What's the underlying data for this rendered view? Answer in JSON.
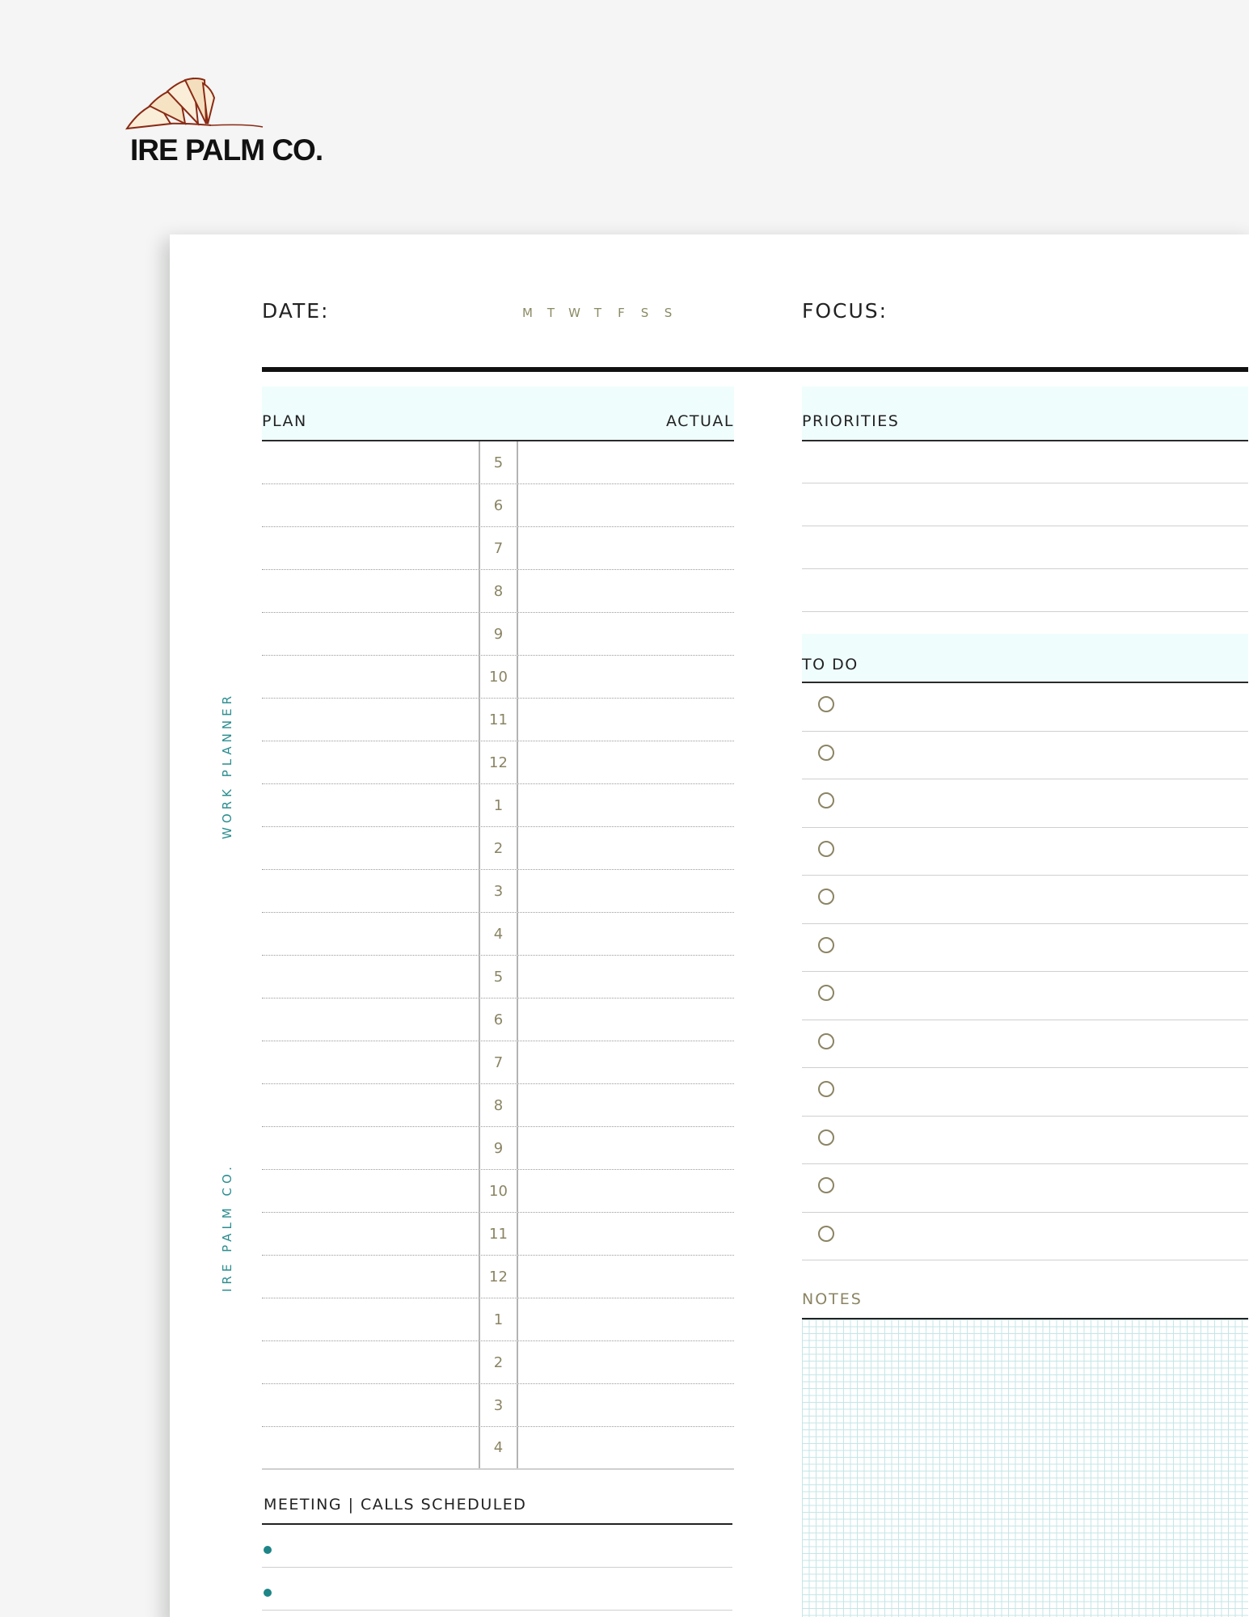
{
  "brand": {
    "name": "IRE PALM CO."
  },
  "side_labels": {
    "top": "WORK PLANNER",
    "bottom": "IRE PALM CO."
  },
  "header": {
    "date_label": "DATE:",
    "days": [
      "M",
      "T",
      "W",
      "T",
      "F",
      "S",
      "S"
    ],
    "focus_label": "FOCUS:"
  },
  "schedule": {
    "plan_label": "PLAN",
    "actual_label": "ACTUAL",
    "hours": [
      "5",
      "6",
      "7",
      "8",
      "9",
      "10",
      "11",
      "12",
      "1",
      "2",
      "3",
      "4",
      "5",
      "6",
      "7",
      "8",
      "9",
      "10",
      "11",
      "12",
      "1",
      "2",
      "3",
      "4"
    ]
  },
  "priorities": {
    "title": "PRIORITIES",
    "line_count": 4
  },
  "todo": {
    "title": "TO DO",
    "item_count": 12
  },
  "notes": {
    "title": "NOTES"
  },
  "meetings": {
    "title": "MEETING | CALLS SCHEDULED",
    "bullet_count": 2
  },
  "colors": {
    "accent": "#2b8d8f",
    "muted": "#8b8463",
    "header_tint": "#f0fdfd"
  }
}
